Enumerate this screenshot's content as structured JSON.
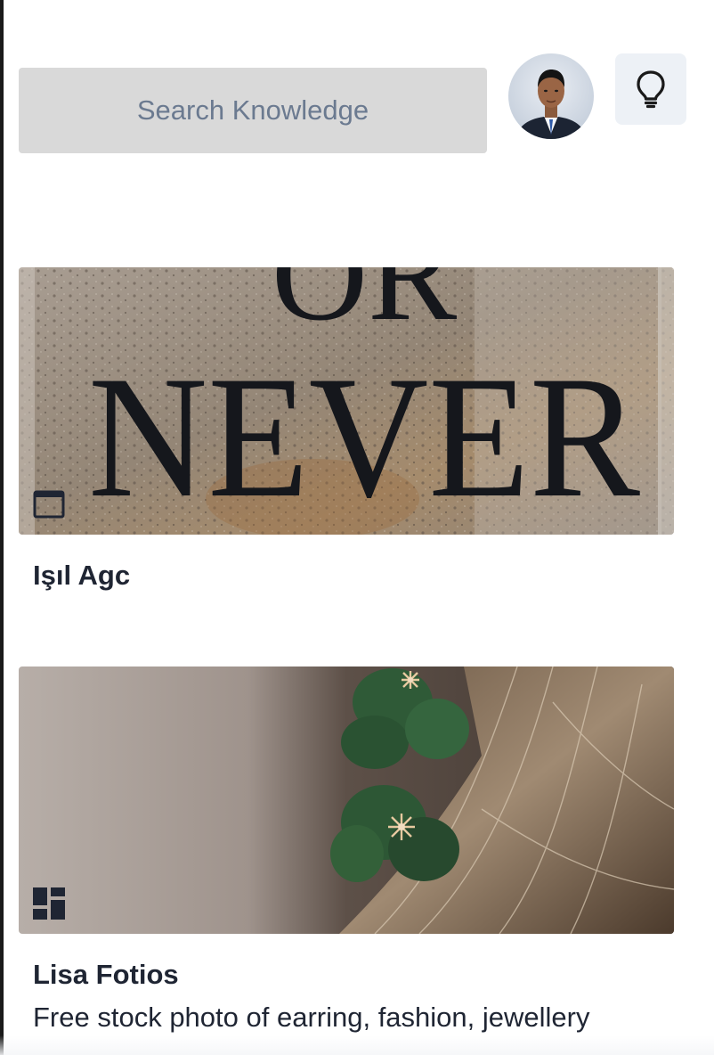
{
  "search": {
    "placeholder": "Search Knowledge"
  },
  "header": {
    "avatar_icon": "user-avatar",
    "idea_icon": "lightbulb-icon"
  },
  "cards": [
    {
      "author": "Işıl Agc",
      "description": "",
      "media_type_icon": "single-image-icon",
      "photo_text": [
        "OR",
        "NEVER"
      ]
    },
    {
      "author": "Lisa Fotios",
      "description": "Free stock photo of earring, fashion, jewellery",
      "media_type_icon": "gallery-layout-icon"
    }
  ],
  "colors": {
    "search_bg": "#d9d9d9",
    "placeholder_text": "#6b7a90",
    "idea_button_bg": "#edf1f6",
    "text": "#1f2533"
  }
}
